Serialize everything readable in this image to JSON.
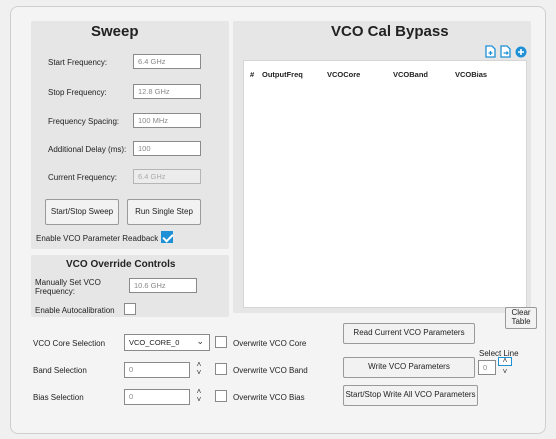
{
  "sweep": {
    "title": "Sweep",
    "start_frequency_label": "Start Frequency:",
    "start_frequency_value": "6.4 GHz",
    "stop_frequency_label": "Stop Frequency:",
    "stop_frequency_value": "12.8 GHz",
    "frequency_spacing_label": "Frequency Spacing:",
    "frequency_spacing_value": "100 MHz",
    "additional_delay_label": "Additional Delay (ms):",
    "additional_delay_value": "100",
    "current_frequency_label": "Current Frequency:",
    "current_frequency_value": "6.4 GHz",
    "start_stop_label": "Start/Stop Sweep",
    "single_step_label": "Run Single Step",
    "readback_label": "Enable VCO Parameter Readback",
    "readback_checked": true
  },
  "override": {
    "title": "VCO Override Controls",
    "manual_label_line1": "Manually Set VCO",
    "manual_label_line2": "Frequency:",
    "manual_value": "10.6 GHz",
    "autocal_label": "Enable Autocalibration",
    "core_label": "VCO Core Selection",
    "core_value": "VCO_CORE_0",
    "overwrite_core_label": "Overwrite VCO Core",
    "band_label": "Band Selection",
    "band_value": "0",
    "overwrite_band_label": "Overwrite VCO Band",
    "bias_label": "Bias Selection",
    "bias_value": "0",
    "overwrite_bias_label": "Overwrite VCO Bias"
  },
  "bypass": {
    "title": "VCO Cal Bypass",
    "columns": [
      "#",
      "OutputFreq",
      "VCOCore",
      "VCOBand",
      "VCOBias"
    ],
    "clear_line1": "Clear",
    "clear_line2": "Table",
    "read_label": "Read Current VCO Parameters",
    "write_label": "Write VCO Parameters",
    "select_line_label": "Select Line",
    "select_line_value": "0",
    "start_stop_write_label": "Start/Stop Write All VCO Parameters"
  },
  "icons": {
    "accent": "#1e90d6"
  }
}
